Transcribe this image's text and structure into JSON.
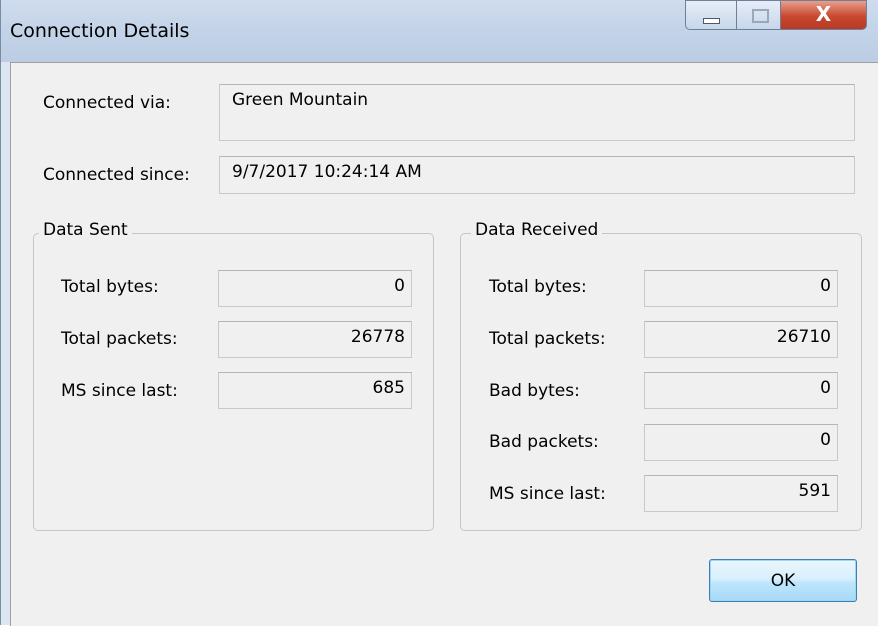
{
  "window": {
    "title": "Connection Details",
    "controls": {
      "minimize_icon": "minimize-icon",
      "maximize_icon": "maximize-icon",
      "close_icon": "close-icon",
      "close_glyph": "X"
    }
  },
  "connection": {
    "via_label": "Connected via:",
    "via_value": "Green Mountain",
    "since_label": "Connected since:",
    "since_value": "9/7/2017 10:24:14 AM"
  },
  "data_sent": {
    "title": "Data Sent",
    "rows": [
      {
        "label": "Total bytes:",
        "value": "0"
      },
      {
        "label": "Total packets:",
        "value": "26778"
      },
      {
        "label": "MS since last:",
        "value": "685"
      }
    ]
  },
  "data_received": {
    "title": "Data Received",
    "rows": [
      {
        "label": "Total bytes:",
        "value": "0"
      },
      {
        "label": "Total packets:",
        "value": "26710"
      },
      {
        "label": "Bad bytes:",
        "value": "0"
      },
      {
        "label": "Bad packets:",
        "value": "0"
      },
      {
        "label": "MS since last:",
        "value": "591"
      }
    ]
  },
  "buttons": {
    "ok_label": "OK"
  },
  "colors": {
    "title_bar": "#c3d3e8",
    "client_background": "#f0f0f0",
    "close_button": "#c8482f",
    "ok_border": "#3c7fb1"
  }
}
